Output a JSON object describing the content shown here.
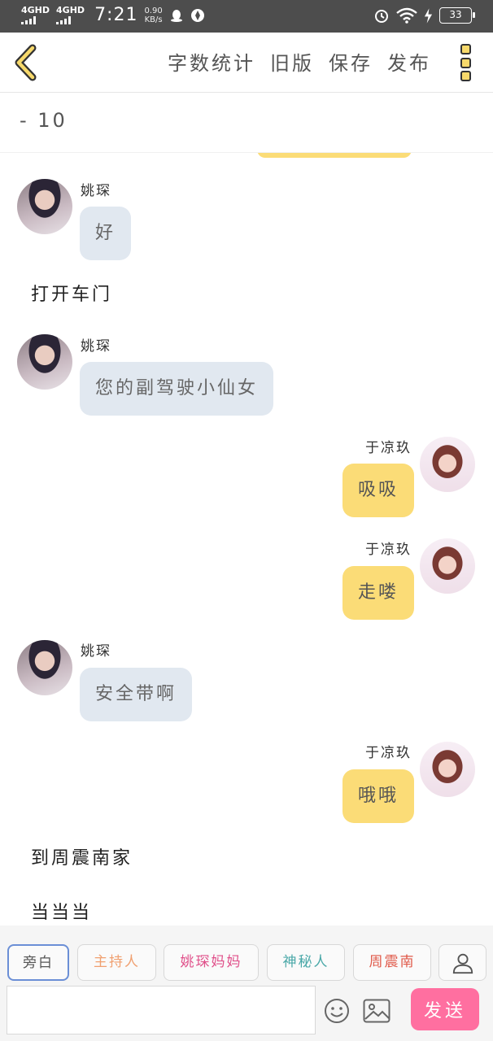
{
  "status_bar": {
    "net1": "4GHD",
    "net2": "4GHD",
    "time": "7:21",
    "speed_value": "0.90",
    "speed_unit": "KB/s",
    "battery": "33"
  },
  "toolbar": {
    "word_count": "字数统计",
    "old_version": "旧版",
    "save": "保存",
    "publish": "发布"
  },
  "title": "- 10",
  "messages": [
    {
      "kind": "left",
      "name": "姚琛",
      "text": "好"
    },
    {
      "kind": "narration",
      "text": "打开车门"
    },
    {
      "kind": "left",
      "name": "姚琛",
      "text": "您的副驾驶小仙女"
    },
    {
      "kind": "right",
      "name": "于凉玖",
      "text": "吸吸"
    },
    {
      "kind": "right",
      "name": "于凉玖",
      "text": "走喽"
    },
    {
      "kind": "left",
      "name": "姚琛",
      "text": "安全带啊"
    },
    {
      "kind": "right",
      "name": "于凉玖",
      "text": "哦哦"
    },
    {
      "kind": "narration",
      "text": "到周震南家"
    },
    {
      "kind": "narration",
      "text": "当当当"
    }
  ],
  "roles": [
    {
      "label": "旁白",
      "color": "#555555",
      "active": true
    },
    {
      "label": "主持人",
      "color": "#f0a070",
      "active": false
    },
    {
      "label": "姚琛妈妈",
      "color": "#e0508a",
      "active": false
    },
    {
      "label": "神秘人",
      "color": "#4aa8a8",
      "active": false
    },
    {
      "label": "周震南",
      "color": "#e05a4a",
      "active": false
    }
  ],
  "input": {
    "placeholder": "",
    "send": "发送"
  },
  "colors": {
    "accent_yellow": "#fbdc77",
    "bubble_blue": "#e1e8f0",
    "send_pink": "#ff6fa0"
  }
}
